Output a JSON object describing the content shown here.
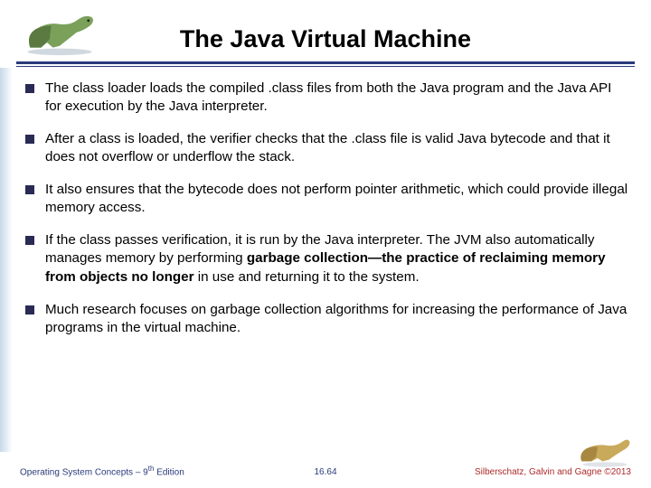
{
  "title": "The Java Virtual Machine",
  "bullets": {
    "b0": "The class loader loads the compiled .class files from both the Java program and the Java API for execution by the Java interpreter.",
    "b1": "After a class is loaded, the verifier checks that the .class file is valid Java bytecode and that it does not overflow or underflow the stack.",
    "b2": "It also ensures that the bytecode does not perform pointer arithmetic, which could provide illegal memory access.",
    "b3_pre": "If the class passes verification, it is run by the Java interpreter. The JVM also automatically manages memory by performing ",
    "b3_bold": "garbage collection—the practice of reclaiming memory from objects no longer",
    "b3_post": " in use and returning it to the system.",
    "b4": "Much research focuses on garbage collection algorithms for increasing the performance of Java programs in the virtual machine."
  },
  "footer": {
    "left_pre": "Operating System Concepts – 9",
    "left_sup": "th",
    "left_post": " Edition",
    "center": "16.64",
    "right": "Silberschatz, Galvin and Gagne ©2013"
  }
}
